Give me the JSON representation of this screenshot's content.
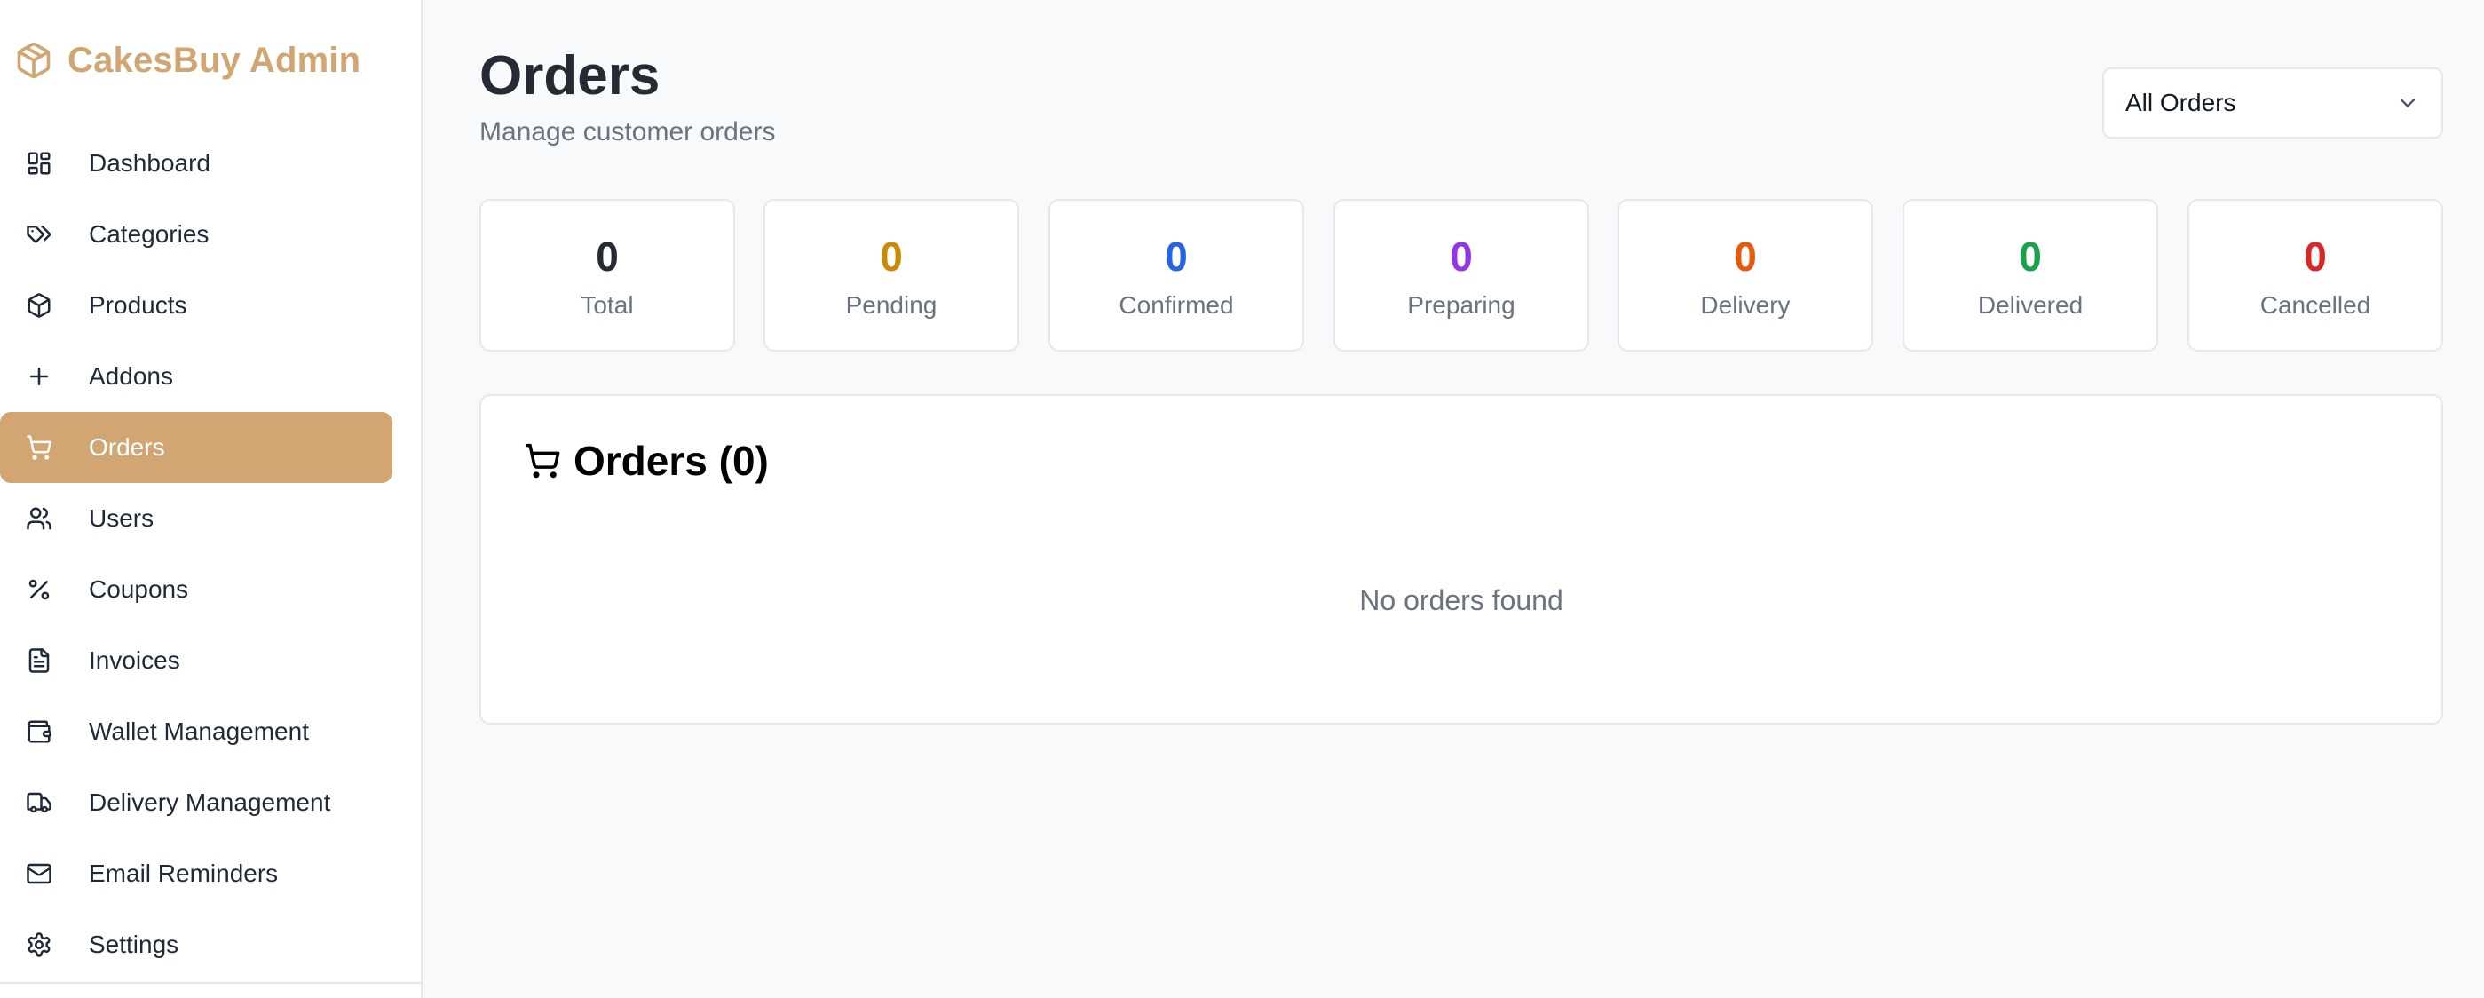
{
  "brand": {
    "title": "CakesBuy Admin",
    "color": "#d2a673"
  },
  "sidebar": {
    "items": [
      {
        "label": "Dashboard",
        "icon": "dashboard-icon"
      },
      {
        "label": "Categories",
        "icon": "tag-icon"
      },
      {
        "label": "Products",
        "icon": "package-icon"
      },
      {
        "label": "Addons",
        "icon": "plus-icon"
      },
      {
        "label": "Orders",
        "icon": "cart-icon",
        "active": true
      },
      {
        "label": "Users",
        "icon": "users-icon"
      },
      {
        "label": "Coupons",
        "icon": "percent-icon"
      },
      {
        "label": "Invoices",
        "icon": "file-text-icon"
      },
      {
        "label": "Wallet Management",
        "icon": "wallet-icon"
      },
      {
        "label": "Delivery Management",
        "icon": "truck-icon"
      },
      {
        "label": "Email Reminders",
        "icon": "mail-icon"
      },
      {
        "label": "Settings",
        "icon": "gear-icon"
      }
    ]
  },
  "header": {
    "title": "Orders",
    "subtitle": "Manage customer orders"
  },
  "filter": {
    "selected": "All Orders"
  },
  "stats": [
    {
      "value": "0",
      "label": "Total",
      "color": "#262b33"
    },
    {
      "value": "0",
      "label": "Pending",
      "color": "#ca8a04"
    },
    {
      "value": "0",
      "label": "Confirmed",
      "color": "#2563eb"
    },
    {
      "value": "0",
      "label": "Preparing",
      "color": "#9333ea"
    },
    {
      "value": "0",
      "label": "Delivery",
      "color": "#ea580c"
    },
    {
      "value": "0",
      "label": "Delivered",
      "color": "#16a34a"
    },
    {
      "value": "0",
      "label": "Cancelled",
      "color": "#dc2626"
    }
  ],
  "orders": {
    "title": "Orders (0)",
    "empty_message": "No orders found"
  }
}
